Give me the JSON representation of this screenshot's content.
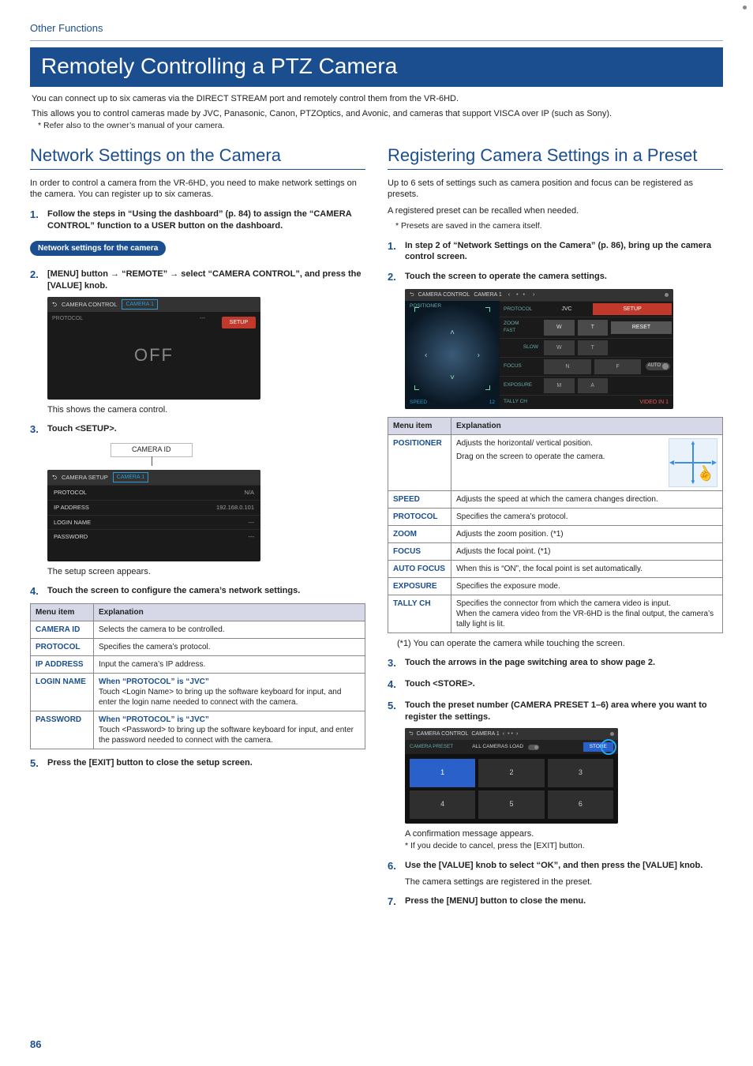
{
  "breadcrumb": "Other Functions",
  "h1": "Remotely Controlling a PTZ Camera",
  "intro_lines": [
    "You can connect up to six cameras via the DIRECT STREAM port and remotely control them from the VR-6HD.",
    "This allows you to control cameras made by JVC, Panasonic, Canon, PTZOptics, and Avonic, and cameras that support VISCA over IP (such as Sony)."
  ],
  "intro_note": "* Refer also to the owner’s manual of your camera.",
  "page_number": "86",
  "left": {
    "h2": "Network Settings on the Camera",
    "para": "In order to control a camera from the VR-6HD, you need to make network settings on the camera. You can register up to six cameras.",
    "step1": "Follow the steps in “Using the dashboard” (p. 84) to assign the “CAMERA CONTROL” function to a USER button on the dashboard.",
    "pill": "Network settings for the camera",
    "step2_pre": "[MENU] button ",
    "step2_mid1": " “REMOTE” ",
    "step2_mid2": " select “CAMERA CONTROL”, and press the [VALUE] knob.",
    "arrow": "→",
    "mock_off": {
      "back": "⮌",
      "title": "CAMERA CONTROL",
      "chip": "CAMERA 1",
      "proto_k": "PROTOCOL",
      "proto_v": "---",
      "setup": "SETUP",
      "off": "OFF"
    },
    "after_off": "This shows the camera control.",
    "step3": "Touch <SETUP>.",
    "callout": "CAMERA ID",
    "mock_setup": {
      "title": "CAMERA SETUP",
      "chip": "CAMERA 1",
      "rows": [
        {
          "k": "PROTOCOL",
          "v": "N/A"
        },
        {
          "k": "IP ADDRESS",
          "v": "192.168.0.101"
        },
        {
          "k": "LOGIN NAME",
          "v": "---"
        },
        {
          "k": "PASSWORD",
          "v": "---"
        }
      ]
    },
    "after_setup": "The setup screen appears.",
    "step4": "Touch the screen to configure the camera’s network settings.",
    "table_headers": {
      "a": "Menu item",
      "b": "Explanation"
    },
    "table_rows": [
      {
        "k": "CAMERA ID",
        "v": "Selects the camera to be controlled."
      },
      {
        "k": "PROTOCOL",
        "v": "Specifies the camera’s protocol."
      },
      {
        "k": "IP ADDRESS",
        "v": "Input the camera’s IP address."
      }
    ],
    "login_row": {
      "k": "LOGIN NAME",
      "head": "When “PROTOCOL” is “JVC”",
      "body": "Touch <Login Name> to bring up the software keyboard for input, and enter the login name needed to connect with the camera."
    },
    "pw_row": {
      "k": "PASSWORD",
      "head": "When “PROTOCOL” is “JVC”",
      "body": "Touch <Password> to bring up the software keyboard for input, and enter the password needed to connect with the camera."
    },
    "step5": "Press the [EXIT] button to close the setup screen."
  },
  "right": {
    "h2": "Registering Camera Settings in a Preset",
    "para1": "Up to 6 sets of settings such as camera position and focus can be registered as presets.",
    "para2": "A registered preset can be recalled when needed.",
    "note": "* Presets are saved in the camera itself.",
    "step1": "In step 2 of “Network Settings on the Camera” (p. 86), bring up the camera control screen.",
    "step2": "Touch the screen to operate the camera settings.",
    "mock_ctrl": {
      "back": "⮌",
      "title": "CAMERA CONTROL",
      "chip": "CAMERA 1",
      "proto_k": "PROTOCOL",
      "proto_v": "JVC",
      "setup": "SETUP",
      "pos": "POSITIONER",
      "zoom": "ZOOM",
      "fast": "FAST",
      "slow": "SLOW",
      "w": "W",
      "t": "T",
      "reset": "RESET",
      "focus": "FOCUS",
      "n": "N",
      "f": "F",
      "auto": "AUTO",
      "exposure": "EXPOSURE",
      "m": "M",
      "a": "A",
      "tally": "TALLY CH",
      "tally_v": "VIDEO IN 1",
      "speed": "SPEED",
      "speed_v": "12"
    },
    "table_headers": {
      "a": "Menu item",
      "b": "Explanation"
    },
    "rows": {
      "positioner_k": "POSITIONER",
      "positioner_v1": "Adjusts the horizontal/ vertical position.",
      "positioner_v2": "Drag on the screen to operate the camera.",
      "speed_k": "SPEED",
      "speed_v": "Adjusts the speed at which the camera changes direction.",
      "proto_k": "PROTOCOL",
      "proto_v": "Specifies the camera’s protocol.",
      "zoom_k": "ZOOM",
      "zoom_v": "Adjusts the zoom position. (*1)",
      "focus_k": "FOCUS",
      "focus_v": "Adjusts the focal point. (*1)",
      "af_k": "AUTO FOCUS",
      "af_v": "When this is “ON”, the focal point is set automatically.",
      "exp_k": "EXPOSURE",
      "exp_v": "Specifies the exposure mode.",
      "tally_k": "TALLY CH",
      "tally_v1": "Specifies the connector from which the camera video is input.",
      "tally_v2": "When the camera video from the VR-6HD is the final output, the camera’s tally light is lit."
    },
    "footnote": "(*1) You can operate the camera while touching the screen.",
    "step3": "Touch the arrows in the page switching area to show page 2.",
    "step4": "Touch <STORE>.",
    "step5": "Touch the preset number (CAMERA PRESET 1–6) area where you want to register the settings.",
    "mock_preset": {
      "back": "⮌",
      "title": "CAMERA CONTROL",
      "chip": "CAMERA 1",
      "label": "CAMERA PRESET",
      "all": "ALL CAMERAS LOAD",
      "store": "STORE",
      "tiles": [
        "1",
        "2",
        "3",
        "4",
        "5",
        "6"
      ]
    },
    "after_preset": "A confirmation message appears.",
    "cancel_note": "* If you decide to cancel, press the [EXIT] button.",
    "step6": "Use the [VALUE] knob to select “OK”, and then press the [VALUE] knob.",
    "after_step6": "The camera settings are registered in the preset.",
    "step7": "Press the [MENU] button to close the menu."
  }
}
